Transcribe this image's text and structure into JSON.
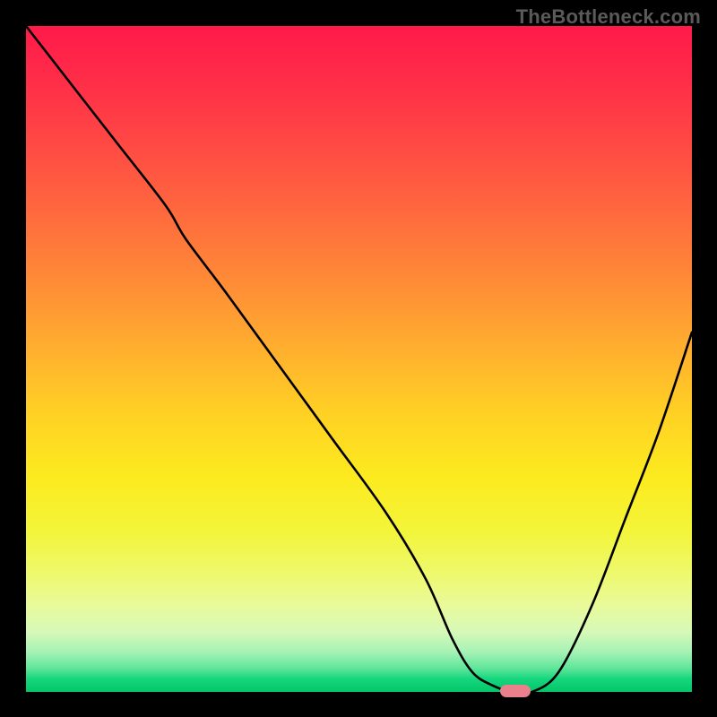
{
  "watermark": "TheBottleneck.com",
  "chart_data": {
    "type": "line",
    "title": "",
    "xlabel": "",
    "ylabel": "",
    "xlim": [
      0,
      100
    ],
    "ylim": [
      0,
      100
    ],
    "grid": false,
    "legend": false,
    "background": "rainbow-gradient-red-to-green",
    "series": [
      {
        "name": "bottleneck-curve",
        "x": [
          0,
          7,
          14,
          21,
          24,
          30,
          38,
          46,
          54,
          60,
          64,
          67,
          70,
          73,
          76,
          80,
          85,
          90,
          95,
          100
        ],
        "y": [
          100,
          91,
          82,
          73,
          68,
          60,
          49,
          38,
          27,
          17,
          8,
          3,
          1,
          0,
          0,
          3,
          13,
          26,
          39,
          54
        ]
      }
    ],
    "marker": {
      "name": "optimal-point",
      "x": 73.5,
      "y": 0,
      "color": "#e9808c"
    }
  }
}
